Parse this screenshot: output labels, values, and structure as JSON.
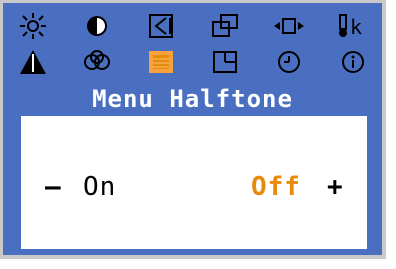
{
  "menu": {
    "title": "Menu Halftone",
    "icons_row1": [
      "brightness-icon",
      "contrast-icon",
      "position-icon",
      "size-icon",
      "width-icon",
      "language-icon"
    ],
    "icons_row2": [
      "geometry-icon",
      "color-icon",
      "halftone-icon",
      "window-icon",
      "timer-icon",
      "info-icon"
    ],
    "language_glyph": "k",
    "selected_icon": "halftone-icon"
  },
  "options": {
    "minus": "–",
    "on": "On",
    "off": "Off",
    "plus": "+",
    "selected": "Off",
    "selected_color": "#e88a0c"
  },
  "colors": {
    "background": "#4a6fc0",
    "panel": "#ffffff",
    "title": "#ffffff",
    "accent": "#e88a0c"
  }
}
